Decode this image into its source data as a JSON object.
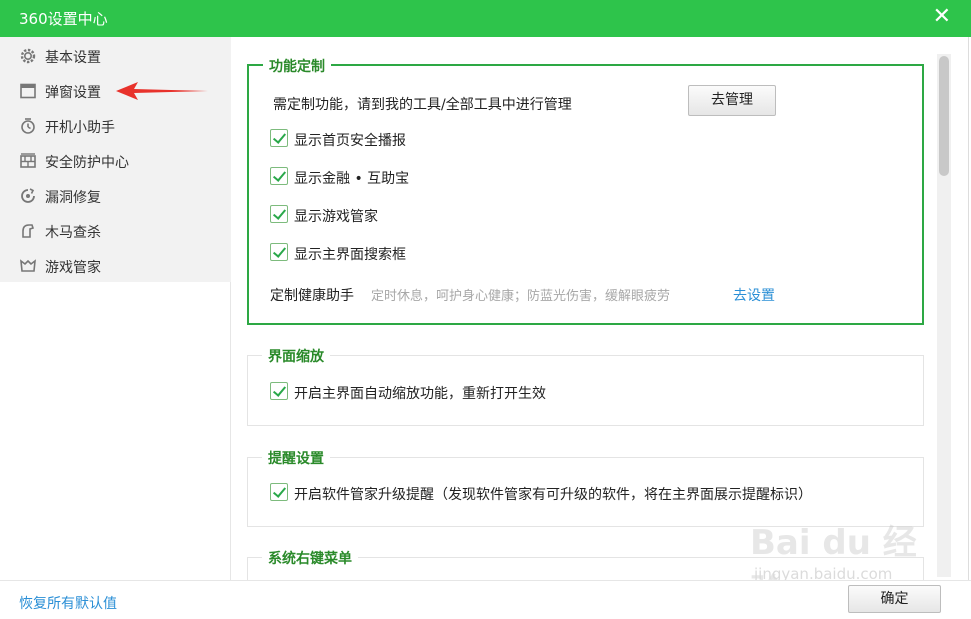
{
  "window": {
    "title": "360设置中心",
    "close_glyph": "✕"
  },
  "sidebar": {
    "items": [
      {
        "label": "基本设置",
        "icon": "gear-icon"
      },
      {
        "label": "弹窗设置",
        "icon": "window-icon"
      },
      {
        "label": "开机小助手",
        "icon": "startup-icon"
      },
      {
        "label": "安全防护中心",
        "icon": "shield-icon"
      },
      {
        "label": "漏洞修复",
        "icon": "repair-icon"
      },
      {
        "label": "木马查杀",
        "icon": "trojan-icon"
      },
      {
        "label": "游戏管家",
        "icon": "game-icon"
      }
    ]
  },
  "sections": {
    "custom": {
      "title": "功能定制",
      "note": "需定制功能，请到我的工具/全部工具中进行管理",
      "manage_button": "去管理",
      "options": [
        {
          "label": "显示首页安全播报",
          "checked": true
        },
        {
          "label": "显示金融 • 互助宝",
          "checked": true
        },
        {
          "label": "显示游戏管家",
          "checked": true
        },
        {
          "label": "显示主界面搜索框",
          "checked": true
        }
      ],
      "health_label": "定制健康助手",
      "health_desc": "定时休息，呵护身心健康；防蓝光伤害，缓解眼疲劳",
      "health_link": "去设置"
    },
    "zoom": {
      "title": "界面缩放",
      "option": {
        "label": "开启主界面自动缩放功能，重新打开生效",
        "checked": true
      }
    },
    "reminder": {
      "title": "提醒设置",
      "option": {
        "label": "开启软件管家升级提醒（发现软件管家有可升级的软件，将在主界面展示提醒标识）",
        "checked": true
      }
    },
    "context_menu": {
      "title": "系统右键菜单"
    }
  },
  "footer": {
    "restore_link": "恢复所有默认值",
    "ok_button": "确定"
  },
  "watermark": {
    "line1": "Bai du 经验",
    "line2": "jingyan.baidu.com"
  },
  "colors": {
    "brand": "#2ec44b",
    "active_border": "#2da844",
    "link": "#2b8fd6",
    "arrow": "#e8322b"
  }
}
